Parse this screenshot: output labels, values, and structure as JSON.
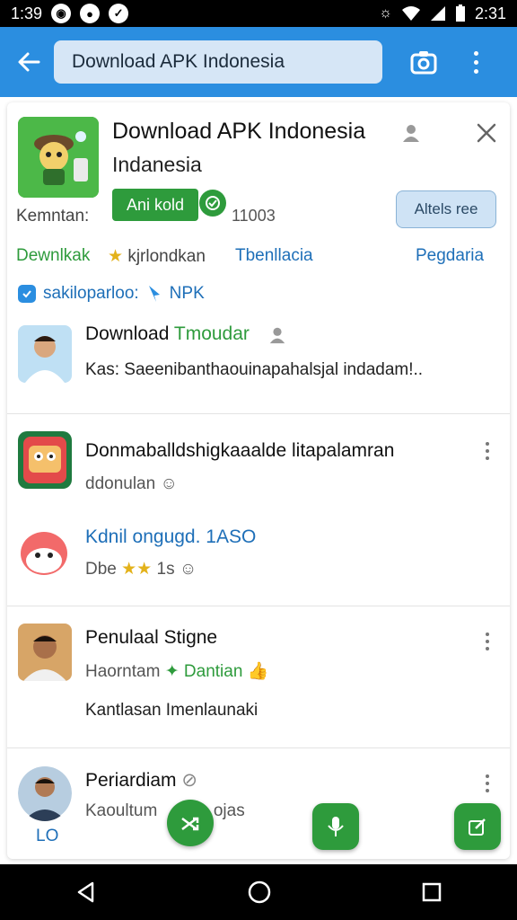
{
  "status_bar": {
    "time_left": "1:39",
    "time_right": "2:31"
  },
  "search": {
    "query": "Download APK Indonesia"
  },
  "app": {
    "title": "Download APK Indonesia",
    "subtitle": "Indanesia",
    "install_label": "Ani kold",
    "meta_label": "Kemntan:",
    "count": "11003",
    "outline_button": "Altels ree",
    "links": [
      "Dewnlkak",
      "kjrlondkan",
      "Tbenllacia",
      "Pegdaria"
    ],
    "link_star": "★",
    "verify_text": "sakiloparloo:",
    "verify_badge": "NPK"
  },
  "items": [
    {
      "title": "Download",
      "title_tag": "Tmoudar",
      "body": "Kas: Saeenibanthaouinapahalsjal indadam!.."
    },
    {
      "title": "Donmaballdshigkaaalde litapalamran",
      "sub": "ddonulan"
    },
    {
      "title": "Kdnil ongugd. 1ASO",
      "sub": "Dbe",
      "stars": "★★",
      "sub_tail": "1s"
    },
    {
      "title": "Penulaal Stigne",
      "sub": "Haorntam",
      "sub_tag": "Dantian",
      "body": "Kantlasan Imenlaunaki"
    },
    {
      "title": "Periardiam",
      "sub": "Kaoultum",
      "sub_tail": "ojas",
      "footer": "LO"
    }
  ],
  "colors": {
    "accent": "#2b8ee0",
    "green": "#2e9b3c",
    "link_blue": "#1e6fb8"
  }
}
